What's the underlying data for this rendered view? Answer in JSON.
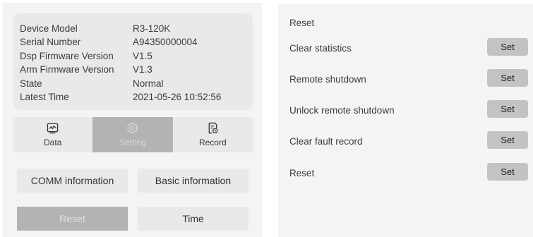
{
  "device_info": {
    "rows": [
      {
        "label": "Device Model",
        "value": "R3-120K"
      },
      {
        "label": "Serial Number",
        "value": "A94350000004"
      },
      {
        "label": "Dsp Firmware Version",
        "value": "V1.5"
      },
      {
        "label": "Arm Firmware Version",
        "value": "V1.3"
      },
      {
        "label": "State",
        "value": "Normal"
      },
      {
        "label": "Latest Time",
        "value": "2021-05-26 10:52:56"
      }
    ]
  },
  "tabs": [
    {
      "label": "Data",
      "icon": "data-chart-icon"
    },
    {
      "label": "Setting",
      "icon": "gear-icon",
      "active": true
    },
    {
      "label": "Record",
      "icon": "record-icon"
    }
  ],
  "setting_buttons": [
    {
      "label": "COMM information"
    },
    {
      "label": "Basic information"
    },
    {
      "label": "Reset",
      "active": true
    },
    {
      "label": "Time"
    }
  ],
  "reset_panel": {
    "title": "Reset",
    "items": [
      {
        "label": "Clear statistics",
        "button": "Set"
      },
      {
        "label": "Remote shutdown",
        "button": "Set"
      },
      {
        "label": "Unlock remote shutdown",
        "button": "Set"
      },
      {
        "label": "Clear fault record",
        "button": "Set"
      },
      {
        "label": "Reset",
        "button": "Set"
      }
    ]
  },
  "colors": {
    "panel_bg": "#f4f4f4",
    "card_bg": "#e9e9e9",
    "active_bg": "#b3b3b3",
    "set_button_bg": "#c3c3c3"
  }
}
